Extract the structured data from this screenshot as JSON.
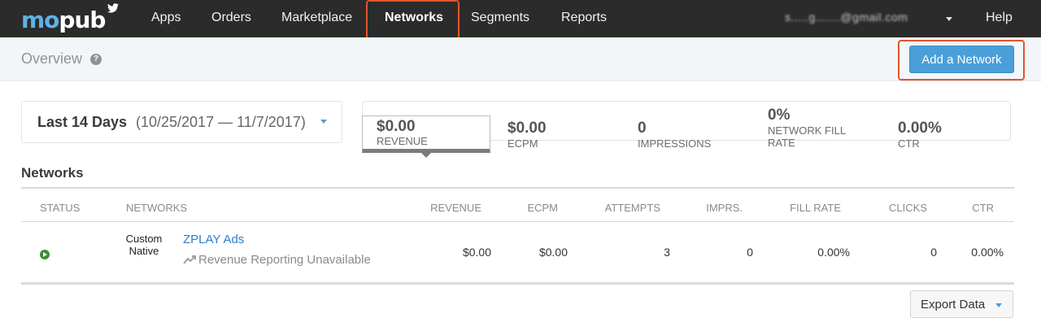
{
  "nav": {
    "logo_mo": "mo",
    "logo_pub": "pub",
    "items": [
      {
        "label": "Apps"
      },
      {
        "label": "Orders"
      },
      {
        "label": "Marketplace"
      },
      {
        "label": "Networks"
      },
      {
        "label": "Segments"
      },
      {
        "label": "Reports"
      }
    ],
    "active": "Networks",
    "account_email": "s.....g.......@gmail.com",
    "help": "Help"
  },
  "subheader": {
    "title": "Overview",
    "help_icon": "?",
    "add_network": "Add a Network"
  },
  "date_filter": {
    "label": "Last 14 Days",
    "range": "(10/25/2017 — 11/7/2017)"
  },
  "stats": [
    {
      "value": "$0.00",
      "label": "REVENUE"
    },
    {
      "value": "$0.00",
      "label": "ECPM"
    },
    {
      "value": "0",
      "label": "IMPRESSIONS"
    },
    {
      "value": "0%",
      "label": "NETWORK FILL RATE"
    },
    {
      "value": "0.00%",
      "label": "CTR"
    }
  ],
  "networks": {
    "title": "Networks",
    "columns": {
      "status": "STATUS",
      "networks": "NETWORKS",
      "revenue": "REVENUE",
      "ecpm": "ECPM",
      "attempts": "ATTEMPTS",
      "imprs": "IMPRS.",
      "fill_rate": "FILL RATE",
      "clicks": "CLICKS",
      "ctr": "CTR"
    },
    "rows": [
      {
        "status_icon": "play-icon",
        "type": "Custom Native",
        "name": "ZPLAY Ads",
        "reporting": "Revenue Reporting Unavailable",
        "revenue": "$0.00",
        "ecpm": "$0.00",
        "attempts": "3",
        "imprs": "0",
        "fill_rate": "0.00%",
        "clicks": "0",
        "ctr": "0.00%"
      }
    ]
  },
  "export": {
    "label": "Export Data"
  },
  "colors": {
    "nav_bg": "#2b2b2b",
    "accent": "#4a9fd9",
    "highlight": "#e4542c",
    "link": "#2a7fcf",
    "status_active": "#3a8e34"
  }
}
